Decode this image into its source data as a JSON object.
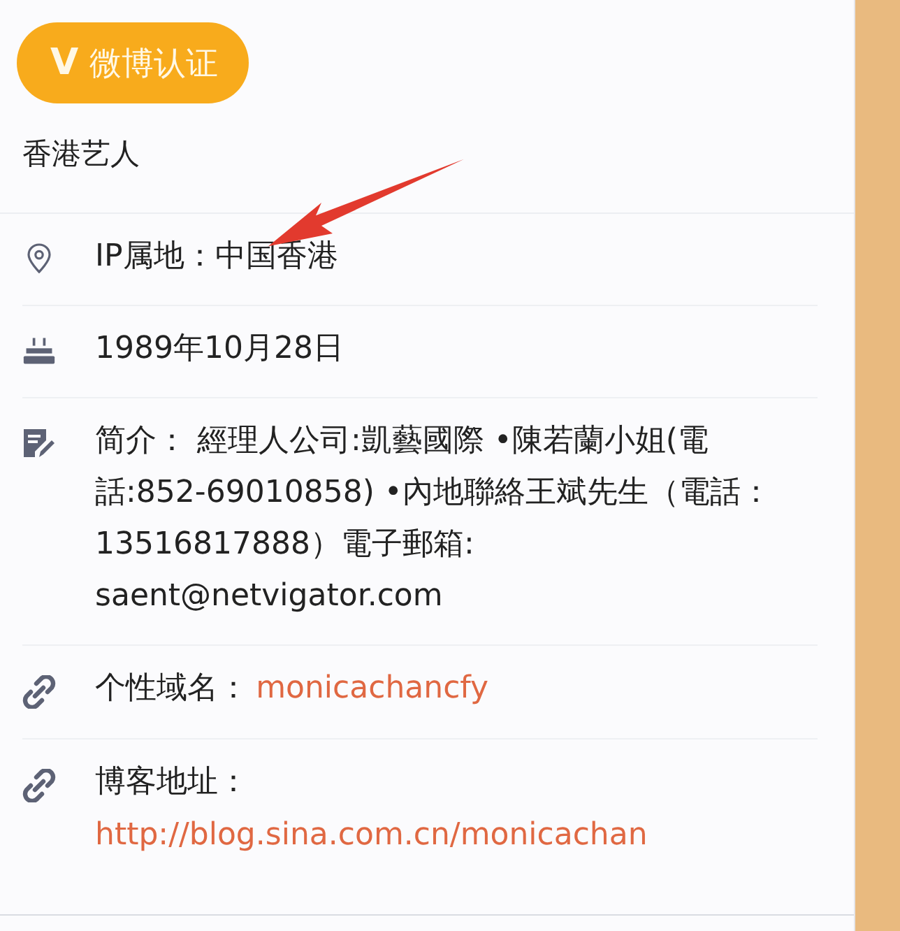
{
  "badge": {
    "icon": "V",
    "label": "微博认证"
  },
  "description": "香港艺人",
  "rows": [
    {
      "kind": "location",
      "text": "IP属地：中国香港"
    },
    {
      "kind": "birthday",
      "text": "1989年10月28日"
    },
    {
      "kind": "note",
      "text": "简介： 經理人公司:凱藝國際 •陳若蘭小姐(電話:852-69010858) •內地聯絡王斌先生（電話：13516817888）電子郵箱: saent@netvigator.com"
    },
    {
      "kind": "link",
      "label": "个性域名：",
      "link": "monicachancfy"
    },
    {
      "kind": "link",
      "label": "博客地址：",
      "link": "http://blog.sina.com.cn/monicachan"
    }
  ],
  "annotation": {
    "kind": "arrow"
  }
}
